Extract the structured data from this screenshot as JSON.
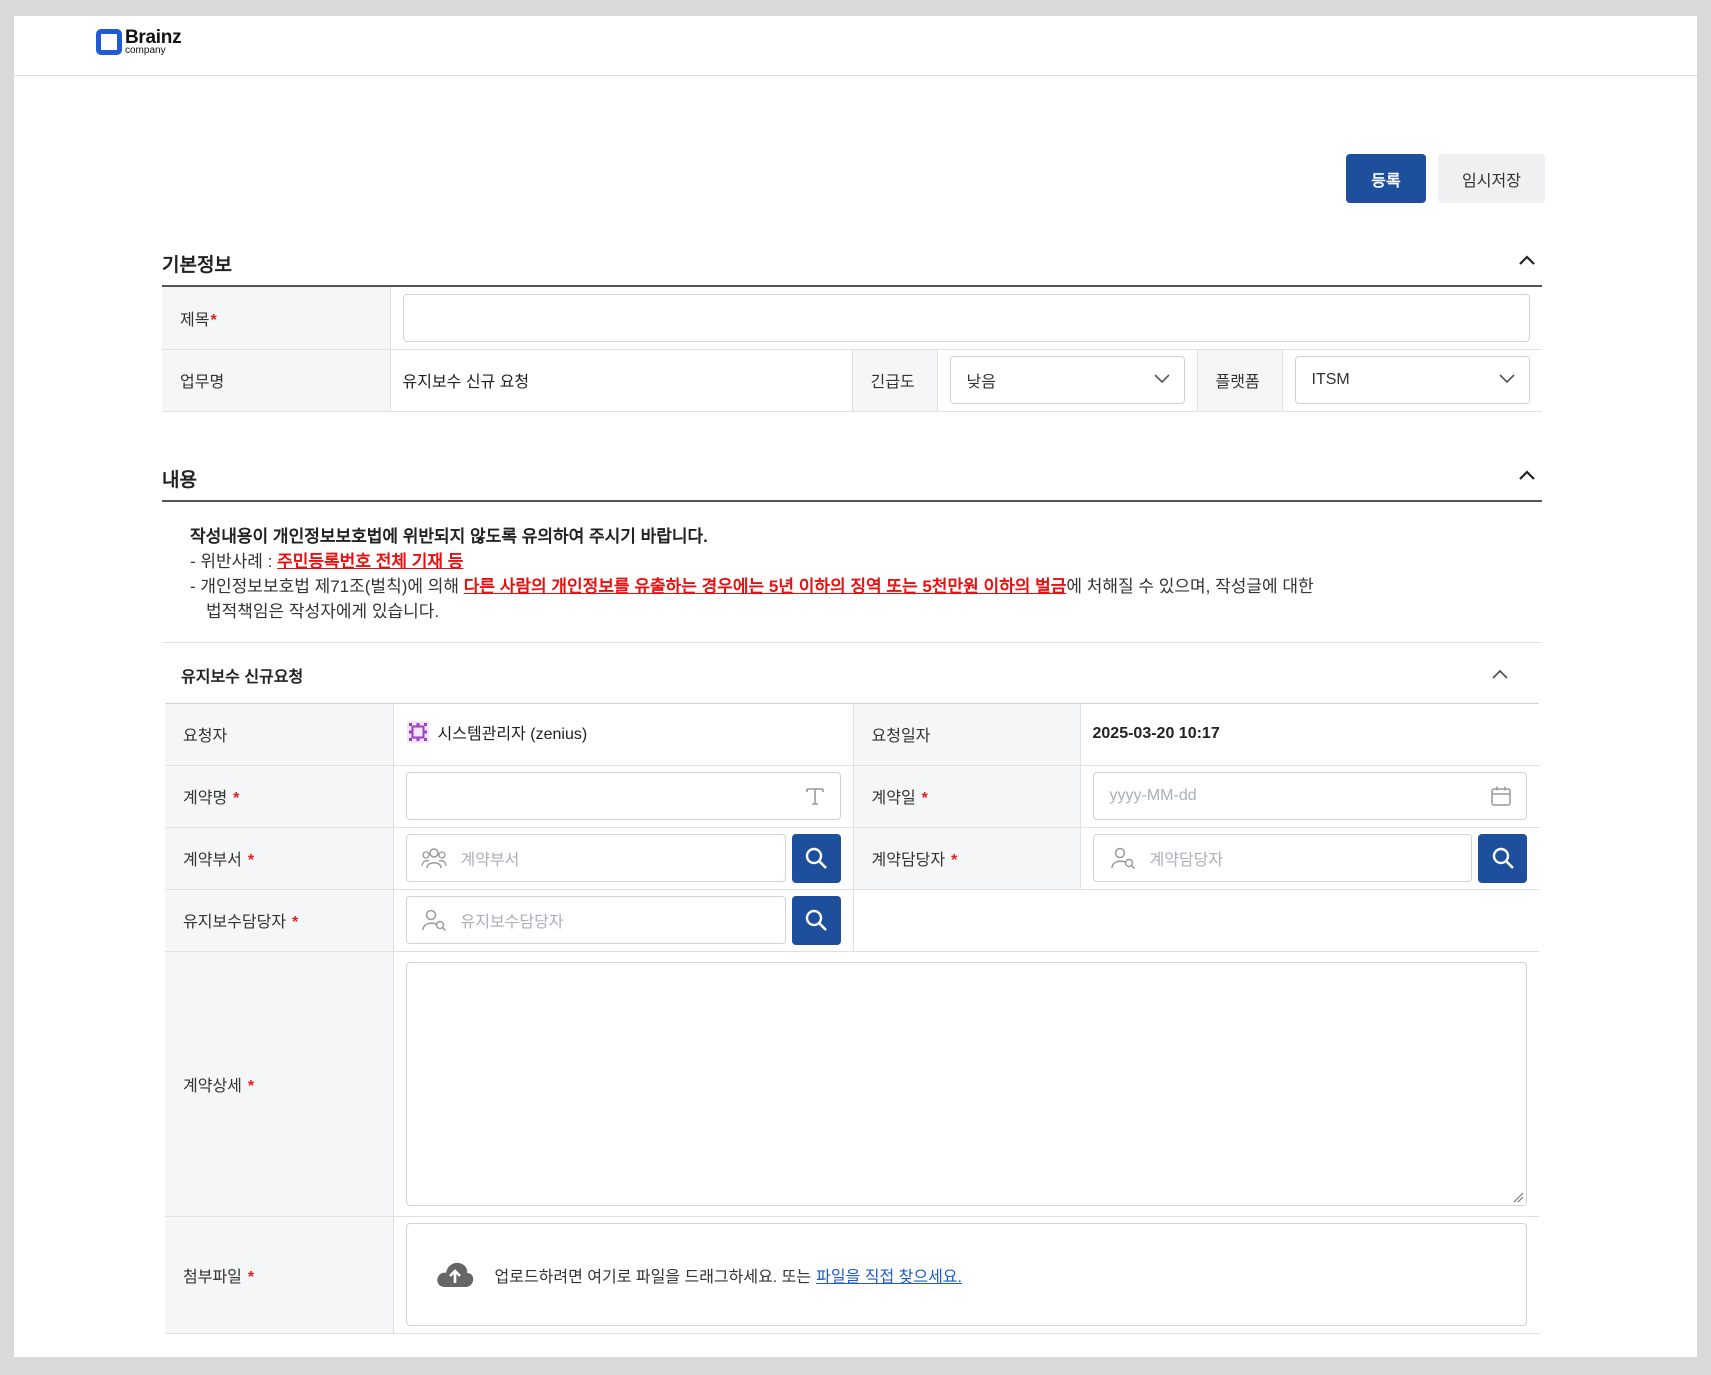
{
  "brand": {
    "name": "Brainz",
    "sub": "company"
  },
  "actions": {
    "register_label": "등록",
    "temp_save_label": "임시저장"
  },
  "basic_info": {
    "title": "기본정보",
    "subject_label": "제목",
    "subject_value": "",
    "task_label": "업무명",
    "task_value": "유지보수 신규 요청",
    "urgency_label": "긴급도",
    "urgency_value": "낮음",
    "platform_label": "플랫폼",
    "platform_value": "ITSM"
  },
  "content": {
    "title": "내용",
    "notice_title": "작성내용이 개인정보보호법에 위반되지 않도록 유의하여 주시기 바랍니다.",
    "notice_case_prefix": "- 위반사례 : ",
    "notice_case_value": "주민등록번호 전체 기재 등",
    "notice_law_prefix": "- 개인정보보호법 제71조(벌칙)에 의해 ",
    "notice_law_highlight": "다른 사람의 개인정보를 유출하는 경우에는 5년 이하의 징역 또는 5천만원 이하의 벌금",
    "notice_law_suffix": "에 처해질 수 있으며, 작성글에 대한",
    "notice_law_line2": "법적책임은 작성자에게 있습니다."
  },
  "request": {
    "title": "유지보수 신규요청",
    "requester_label": "요청자",
    "requester_value": "시스템관리자 (zenius)",
    "request_date_label": "요청일자",
    "request_date_value": "2025-03-20 10:17",
    "contract_name_label": "계약명",
    "contract_name_value": "",
    "contract_date_label": "계약일",
    "contract_date_placeholder": "yyyy-MM-dd",
    "contract_dept_label": "계약부서",
    "contract_dept_placeholder": "계약부서",
    "contract_manager_label": "계약담당자",
    "contract_manager_placeholder": "계약담당자",
    "maint_manager_label": "유지보수담당자",
    "maint_manager_placeholder": "유지보수담당자",
    "contract_detail_label": "계약상세",
    "attachment_label": "첨부파일",
    "upload_text": "업로드하려면 여기로 파일을 드래그하세요. 또는",
    "upload_link": "파일을 직접 찾으세요.",
    "required_mark": "*"
  },
  "colors": {
    "primary": "#1e4f9c",
    "required": "#e02020",
    "warning": "#e81010",
    "link": "#1e5bd0"
  }
}
